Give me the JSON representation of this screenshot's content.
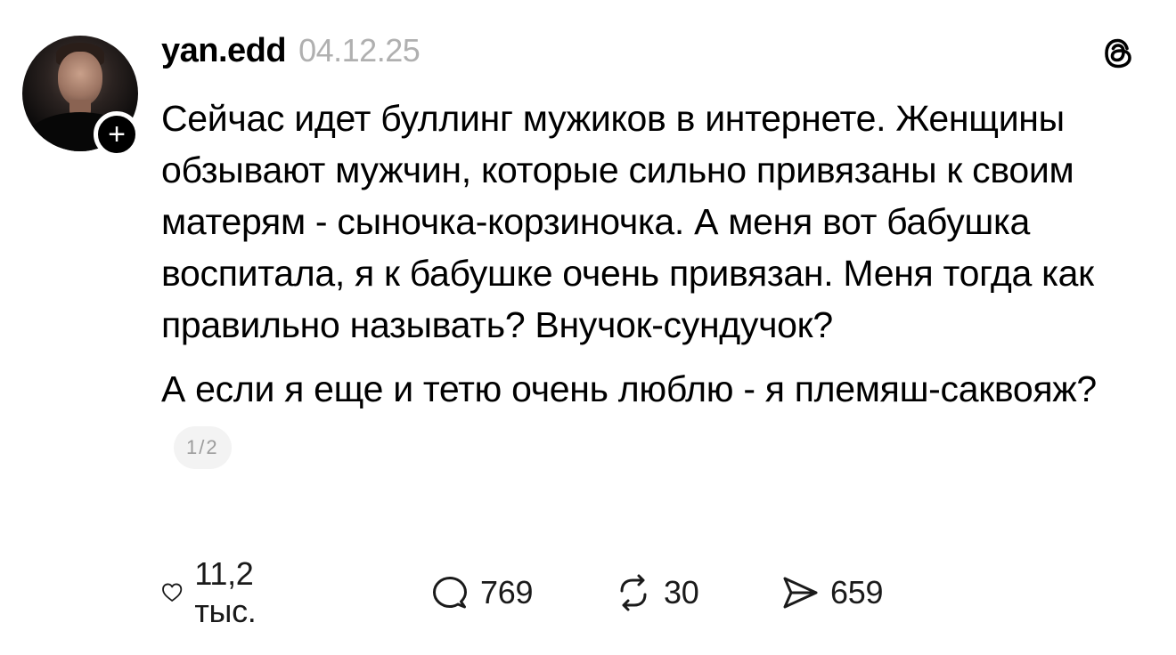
{
  "post": {
    "username": "yan.edd",
    "date": "04.12.25",
    "text_paragraph_1": "Сейчас идет буллинг мужиков в интернете. Женщины обзывают мужчин, которые сильно привязаны к своим матерям - сыночка-корзиночка. А меня вот бабушка воспитала, я к бабушке очень привязан. Меня тогда как правильно называть? Внучок-сундучок?",
    "text_paragraph_2": "А если я еще и тетю очень люблю - я племяш-саквояж?",
    "page_indicator": "1/2",
    "follow_symbol": "+"
  },
  "actions": {
    "likes": "11,2 тыс.",
    "comments": "769",
    "reposts": "30",
    "shares": "659"
  },
  "icons": [
    "avatar",
    "follow-plus-icon",
    "threads-logo-icon",
    "heart-icon",
    "comment-icon",
    "repost-icon",
    "share-icon"
  ]
}
